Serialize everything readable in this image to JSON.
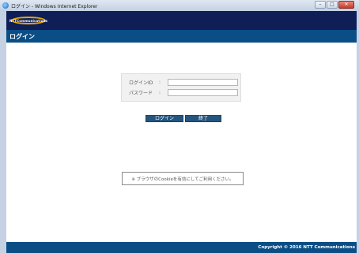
{
  "window": {
    "title": "ログイン - Windows Internet Explorer",
    "controls": {
      "minimize": "–",
      "maximize": "□",
      "close": "✕"
    }
  },
  "logo": {
    "text": "NTTCommunications"
  },
  "header": {
    "title": "ログイン"
  },
  "login_form": {
    "fields": [
      {
        "label": "ログインID",
        "separator": ":",
        "value": ""
      },
      {
        "label": "パスワード",
        "separator": ":",
        "value": ""
      }
    ],
    "buttons": {
      "login": "ログイン",
      "exit": "終了"
    }
  },
  "notice": {
    "text": "※ ブラウザのCookieを有効にしてご利用ください。"
  },
  "footer": {
    "copyright": "Copyright © 2016 NTT Communications"
  },
  "colors": {
    "navy": "#0f1e57",
    "header_blue": "#0b4e86",
    "button_blue": "#24557f",
    "logo_gold": "#e8a800"
  }
}
